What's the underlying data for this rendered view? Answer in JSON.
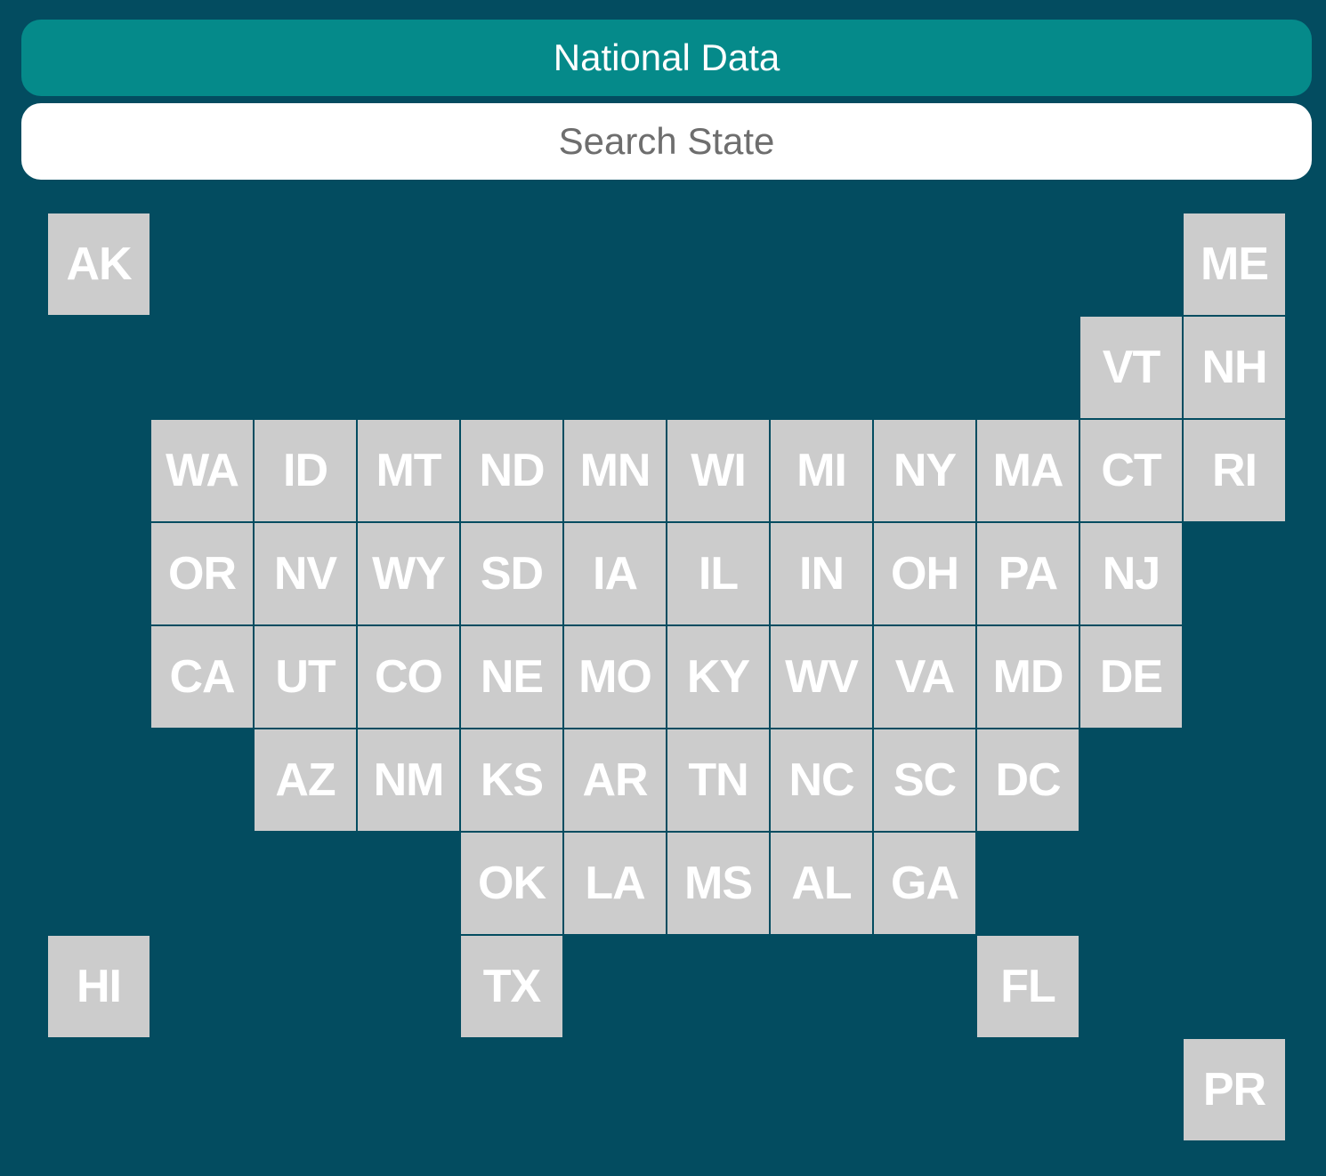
{
  "header": {
    "national_button_label": "National Data"
  },
  "search": {
    "placeholder": "Search State",
    "value": ""
  },
  "colors": {
    "background": "#034c60",
    "national_button": "#058a8a",
    "tile": "#cccccc",
    "tile_text": "#ffffff"
  },
  "states": [
    {
      "abbr": "AK",
      "row": 0,
      "col": 0
    },
    {
      "abbr": "ME",
      "row": 0,
      "col": 11
    },
    {
      "abbr": "VT",
      "row": 1,
      "col": 10
    },
    {
      "abbr": "NH",
      "row": 1,
      "col": 11
    },
    {
      "abbr": "WA",
      "row": 2,
      "col": 1
    },
    {
      "abbr": "ID",
      "row": 2,
      "col": 2
    },
    {
      "abbr": "MT",
      "row": 2,
      "col": 3
    },
    {
      "abbr": "ND",
      "row": 2,
      "col": 4
    },
    {
      "abbr": "MN",
      "row": 2,
      "col": 5
    },
    {
      "abbr": "WI",
      "row": 2,
      "col": 6
    },
    {
      "abbr": "MI",
      "row": 2,
      "col": 7
    },
    {
      "abbr": "NY",
      "row": 2,
      "col": 8
    },
    {
      "abbr": "MA",
      "row": 2,
      "col": 9
    },
    {
      "abbr": "CT",
      "row": 2,
      "col": 10
    },
    {
      "abbr": "RI",
      "row": 2,
      "col": 11
    },
    {
      "abbr": "OR",
      "row": 3,
      "col": 1
    },
    {
      "abbr": "NV",
      "row": 3,
      "col": 2
    },
    {
      "abbr": "WY",
      "row": 3,
      "col": 3
    },
    {
      "abbr": "SD",
      "row": 3,
      "col": 4
    },
    {
      "abbr": "IA",
      "row": 3,
      "col": 5
    },
    {
      "abbr": "IL",
      "row": 3,
      "col": 6
    },
    {
      "abbr": "IN",
      "row": 3,
      "col": 7
    },
    {
      "abbr": "OH",
      "row": 3,
      "col": 8
    },
    {
      "abbr": "PA",
      "row": 3,
      "col": 9
    },
    {
      "abbr": "NJ",
      "row": 3,
      "col": 10
    },
    {
      "abbr": "CA",
      "row": 4,
      "col": 1
    },
    {
      "abbr": "UT",
      "row": 4,
      "col": 2
    },
    {
      "abbr": "CO",
      "row": 4,
      "col": 3
    },
    {
      "abbr": "NE",
      "row": 4,
      "col": 4
    },
    {
      "abbr": "MO",
      "row": 4,
      "col": 5
    },
    {
      "abbr": "KY",
      "row": 4,
      "col": 6
    },
    {
      "abbr": "WV",
      "row": 4,
      "col": 7
    },
    {
      "abbr": "VA",
      "row": 4,
      "col": 8
    },
    {
      "abbr": "MD",
      "row": 4,
      "col": 9
    },
    {
      "abbr": "DE",
      "row": 4,
      "col": 10
    },
    {
      "abbr": "AZ",
      "row": 5,
      "col": 2
    },
    {
      "abbr": "NM",
      "row": 5,
      "col": 3
    },
    {
      "abbr": "KS",
      "row": 5,
      "col": 4
    },
    {
      "abbr": "AR",
      "row": 5,
      "col": 5
    },
    {
      "abbr": "TN",
      "row": 5,
      "col": 6
    },
    {
      "abbr": "NC",
      "row": 5,
      "col": 7
    },
    {
      "abbr": "SC",
      "row": 5,
      "col": 8
    },
    {
      "abbr": "DC",
      "row": 5,
      "col": 9
    },
    {
      "abbr": "OK",
      "row": 6,
      "col": 4
    },
    {
      "abbr": "LA",
      "row": 6,
      "col": 5
    },
    {
      "abbr": "MS",
      "row": 6,
      "col": 6
    },
    {
      "abbr": "AL",
      "row": 6,
      "col": 7
    },
    {
      "abbr": "GA",
      "row": 6,
      "col": 8
    },
    {
      "abbr": "HI",
      "row": 7,
      "col": 0
    },
    {
      "abbr": "TX",
      "row": 7,
      "col": 4
    },
    {
      "abbr": "FL",
      "row": 7,
      "col": 9
    },
    {
      "abbr": "PR",
      "row": 8,
      "col": 11
    }
  ]
}
